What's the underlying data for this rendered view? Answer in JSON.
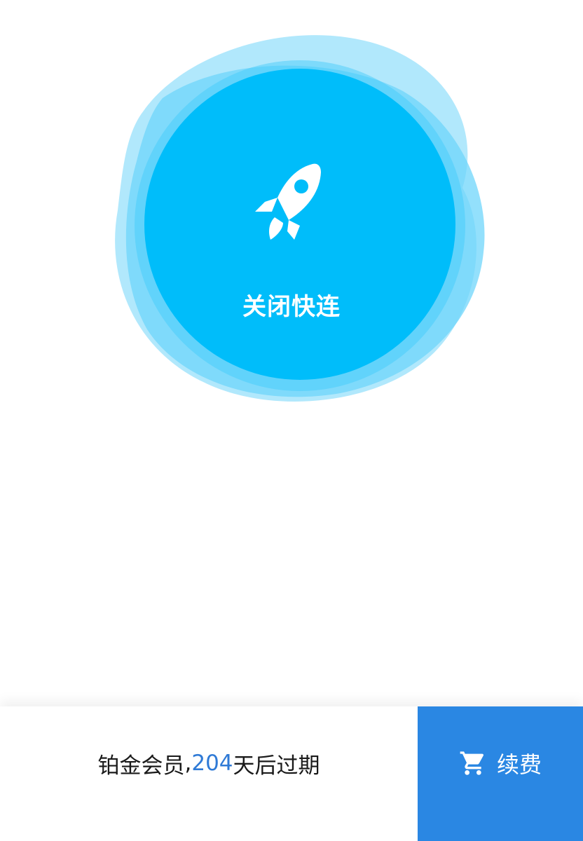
{
  "connect": {
    "label": "关闭快连",
    "icon": "rocket-icon",
    "colors": {
      "core": "#00bdfa",
      "halo_1": "#6fd5fb",
      "halo_2": "#a8e6fc"
    }
  },
  "membership": {
    "tier": "铂金会员",
    "separator": ", ",
    "days": "204",
    "suffix": " 天后过期"
  },
  "renew": {
    "label": "续费",
    "icon": "cart-icon",
    "color": "#2a87e3"
  }
}
